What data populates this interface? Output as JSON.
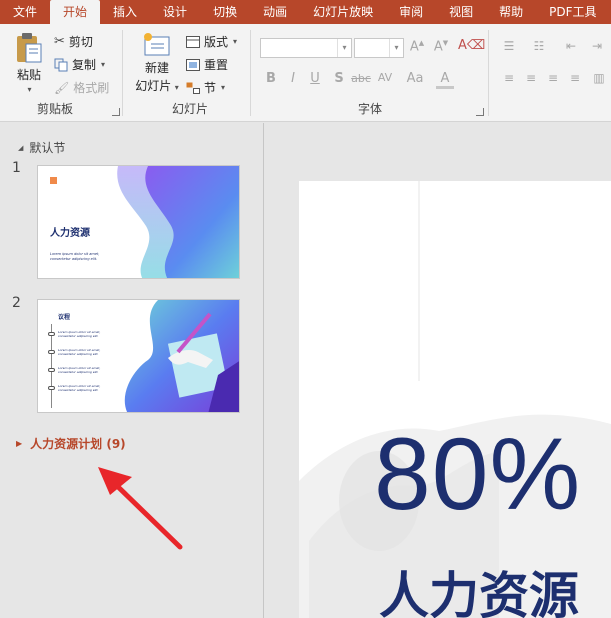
{
  "ribbon_tabs": [
    "文件",
    "开始",
    "插入",
    "设计",
    "切换",
    "动画",
    "幻灯片放映",
    "审阅",
    "视图",
    "帮助",
    "PDF工具"
  ],
  "active_tab": "开始",
  "clipboard": {
    "paste": "粘贴",
    "cut": "剪切",
    "copy": "复制",
    "format_painter": "格式刷",
    "group_label": "剪贴板"
  },
  "slides_group": {
    "new_slide_line1": "新建",
    "new_slide_line2": "幻灯片",
    "layout": "版式",
    "reset": "重置",
    "section": "节",
    "group_label": "幻灯片"
  },
  "font_group": {
    "group_label": "字体",
    "buttons": [
      "B",
      "I",
      "U",
      "S",
      "abc",
      "AV",
      "Aa",
      "A"
    ]
  },
  "sections": {
    "default": "默认节",
    "collapsed": "人力资源计划 (9)"
  },
  "thumbnails": [
    {
      "number": "1",
      "title": "人力资源",
      "subtitle_line1": "Lorem ipsum dolor sit amet,",
      "subtitle_line2": "consectetur adipiscing elit."
    },
    {
      "number": "2",
      "title": "议程",
      "agenda_items": [
        "Lorem ipsum dolor sit amet, consectetur adipiscing elit.",
        "Lorem ipsum dolor sit amet, consectetur adipiscing elit.",
        "Lorem ipsum dolor sit amet, consectetur adipiscing elit.",
        "Lorem ipsum dolor sit amet, consectetur adipiscing elit."
      ]
    }
  ],
  "current_slide": {
    "big_number": "80%",
    "title": "人力资源"
  },
  "colors": {
    "accent": "#b7472a",
    "slide_navy": "#1d2f6f",
    "arrow": "#e8262a"
  }
}
